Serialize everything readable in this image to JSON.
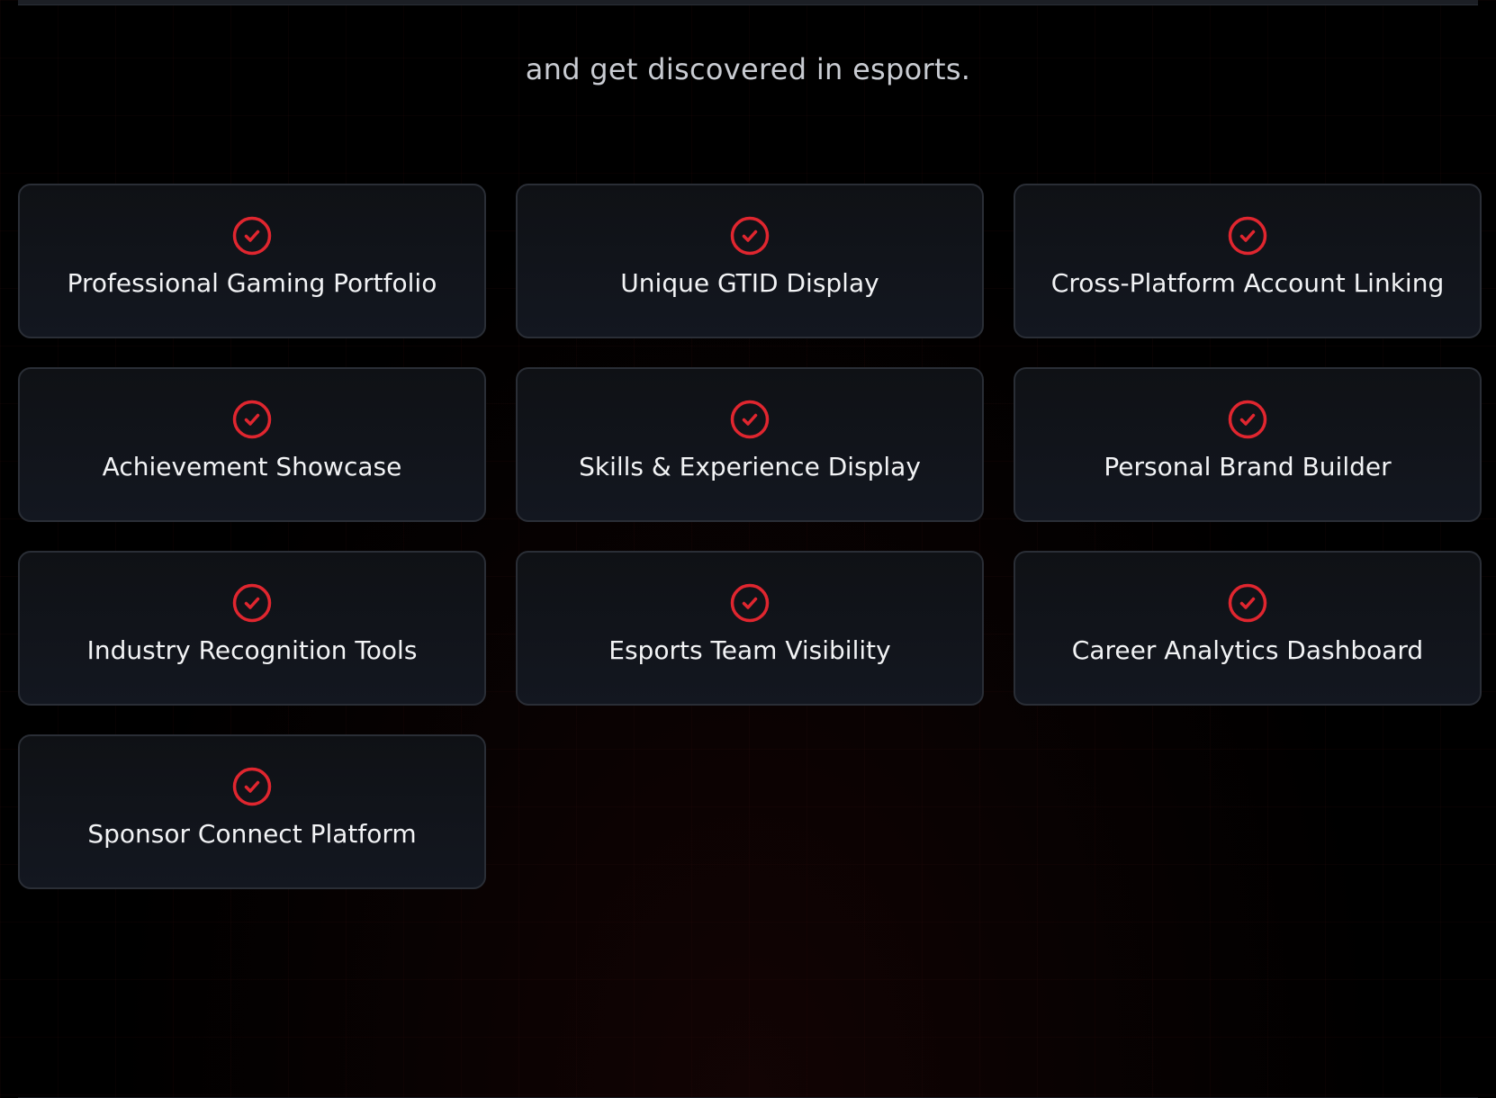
{
  "hero": {
    "subtitle": "and get discovered in esports."
  },
  "colors": {
    "accent": "#e0262f",
    "card_text": "#f2f3f5",
    "subtitle_text": "#c9ccd2",
    "card_border": "#2a2e36",
    "page_background": "#000000"
  },
  "features": [
    {
      "label": "Professional Gaming Portfolio",
      "icon": "check-circle-icon"
    },
    {
      "label": "Unique GTID Display",
      "icon": "check-circle-icon"
    },
    {
      "label": "Cross-Platform Account Linking",
      "icon": "check-circle-icon"
    },
    {
      "label": "Achievement Showcase",
      "icon": "check-circle-icon"
    },
    {
      "label": "Skills & Experience Display",
      "icon": "check-circle-icon"
    },
    {
      "label": "Personal Brand Builder",
      "icon": "check-circle-icon"
    },
    {
      "label": "Industry Recognition Tools",
      "icon": "check-circle-icon"
    },
    {
      "label": "Esports Team Visibility",
      "icon": "check-circle-icon"
    },
    {
      "label": "Career Analytics Dashboard",
      "icon": "check-circle-icon"
    },
    {
      "label": "Sponsor Connect Platform",
      "icon": "check-circle-icon"
    }
  ]
}
